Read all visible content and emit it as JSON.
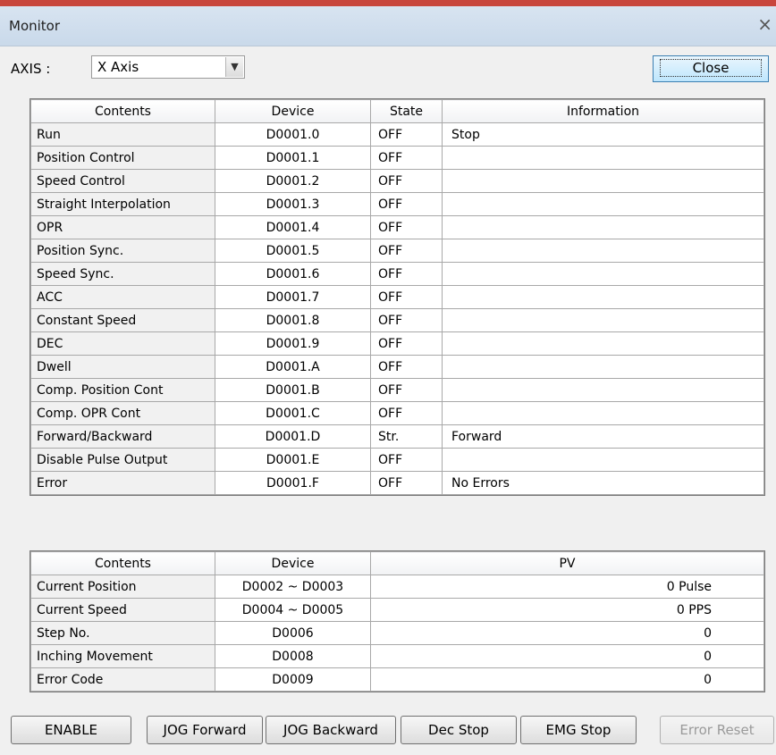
{
  "window": {
    "title": "Monitor",
    "close_glyph": "×"
  },
  "axis": {
    "label": "AXIS :",
    "value": "X Axis",
    "dropdown_glyph": "▼"
  },
  "close_button": {
    "label": "Close"
  },
  "status_table": {
    "headers": [
      "Contents",
      "Device",
      "State",
      "Information"
    ],
    "rows": [
      [
        "Run",
        "D0001.0",
        "OFF",
        "Stop"
      ],
      [
        "Position Control",
        "D0001.1",
        "OFF",
        ""
      ],
      [
        "Speed Control",
        "D0001.2",
        "OFF",
        ""
      ],
      [
        "Straight Interpolation",
        "D0001.3",
        "OFF",
        ""
      ],
      [
        "OPR",
        "D0001.4",
        "OFF",
        ""
      ],
      [
        "Position Sync.",
        "D0001.5",
        "OFF",
        ""
      ],
      [
        "Speed Sync.",
        "D0001.6",
        "OFF",
        ""
      ],
      [
        "ACC",
        "D0001.7",
        "OFF",
        ""
      ],
      [
        "Constant Speed",
        "D0001.8",
        "OFF",
        ""
      ],
      [
        "DEC",
        "D0001.9",
        "OFF",
        ""
      ],
      [
        "Dwell",
        "D0001.A",
        "OFF",
        ""
      ],
      [
        "Comp. Position Cont",
        "D0001.B",
        "OFF",
        ""
      ],
      [
        "Comp. OPR Cont",
        "D0001.C",
        "OFF",
        ""
      ],
      [
        "Forward/Backward",
        "D0001.D",
        "Str.",
        "Forward"
      ],
      [
        "Disable Pulse Output",
        "D0001.E",
        "OFF",
        ""
      ],
      [
        "Error",
        "D0001.F",
        "OFF",
        "No Errors"
      ]
    ]
  },
  "pv_table": {
    "headers": [
      "Contents",
      "Device",
      "PV"
    ],
    "rows": [
      [
        "Current Position",
        "D0002 ~ D0003",
        "0 Pulse"
      ],
      [
        "Current Speed",
        "D0004 ~ D0005",
        "0 PPS"
      ],
      [
        "Step No.",
        "D0006",
        "0"
      ],
      [
        "Inching Movement",
        "D0008",
        "0"
      ],
      [
        "Error Code",
        "D0009",
        "0"
      ]
    ]
  },
  "buttons": {
    "enable": "ENABLE",
    "jog_forward": "JOG Forward",
    "jog_backward": "JOG Backward",
    "dec_stop": "Dec Stop",
    "emg_stop": "EMG Stop",
    "error_reset": "Error Reset"
  }
}
